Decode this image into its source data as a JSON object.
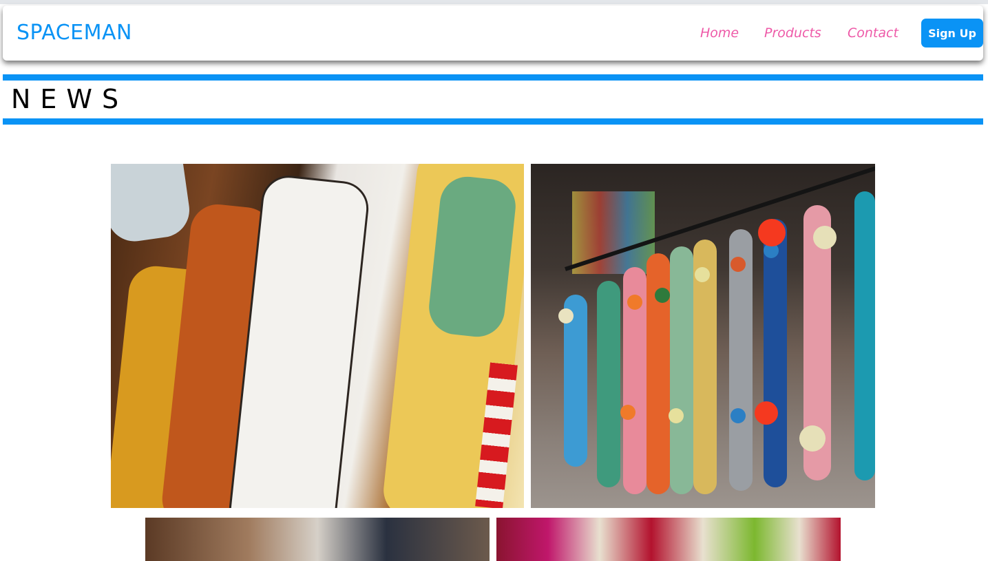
{
  "brand": {
    "name": "SPACEMAN"
  },
  "nav": {
    "links": [
      "Home",
      "Products",
      "Contact"
    ],
    "signup_label": "Sign Up"
  },
  "section": {
    "title": "NEWS"
  },
  "colors": {
    "primary_blue": "#0a93f5",
    "nav_link_pink": "#ee5aa8",
    "background": "#ffffff",
    "title_text": "#000000"
  },
  "gallery": [
    {
      "subject": "skateboard decks on wall"
    },
    {
      "subject": "penny cruiser boards on rack"
    },
    {
      "subject": "shoe close-up"
    },
    {
      "subject": "patterned socks display"
    }
  ]
}
